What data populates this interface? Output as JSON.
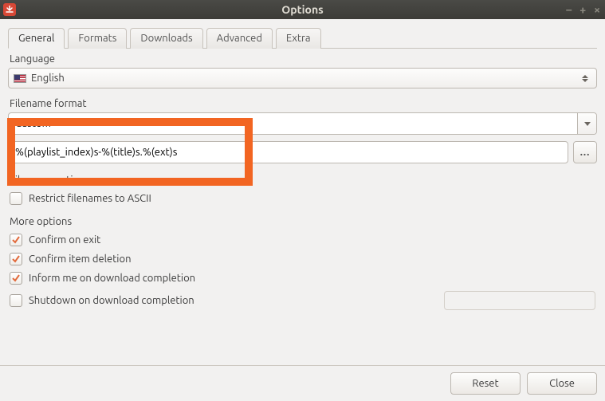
{
  "window": {
    "title": "Options"
  },
  "tabs": {
    "general": "General",
    "formats": "Formats",
    "downloads": "Downloads",
    "advanced": "Advanced",
    "extra": "Extra"
  },
  "labels": {
    "language": "Language",
    "filename_format": "Filename format",
    "filename_options": "Filename options",
    "more_options": "More options"
  },
  "language": {
    "value": "English"
  },
  "filename_format": {
    "preset": "Custom",
    "template": "%(playlist_index)s-%(title)s.%(ext)s",
    "browse": "..."
  },
  "filename_options": {
    "restrict_ascii": {
      "label": "Restrict filenames to ASCII",
      "checked": false
    }
  },
  "more_options": {
    "confirm_exit": {
      "label": "Confirm on exit",
      "checked": true
    },
    "confirm_delete": {
      "label": "Confirm item deletion",
      "checked": true
    },
    "inform_complete": {
      "label": "Inform me on download completion",
      "checked": true
    },
    "shutdown_complete": {
      "label": "Shutdown on download completion",
      "checked": false
    }
  },
  "buttons": {
    "reset": "Reset",
    "close": "Close"
  }
}
